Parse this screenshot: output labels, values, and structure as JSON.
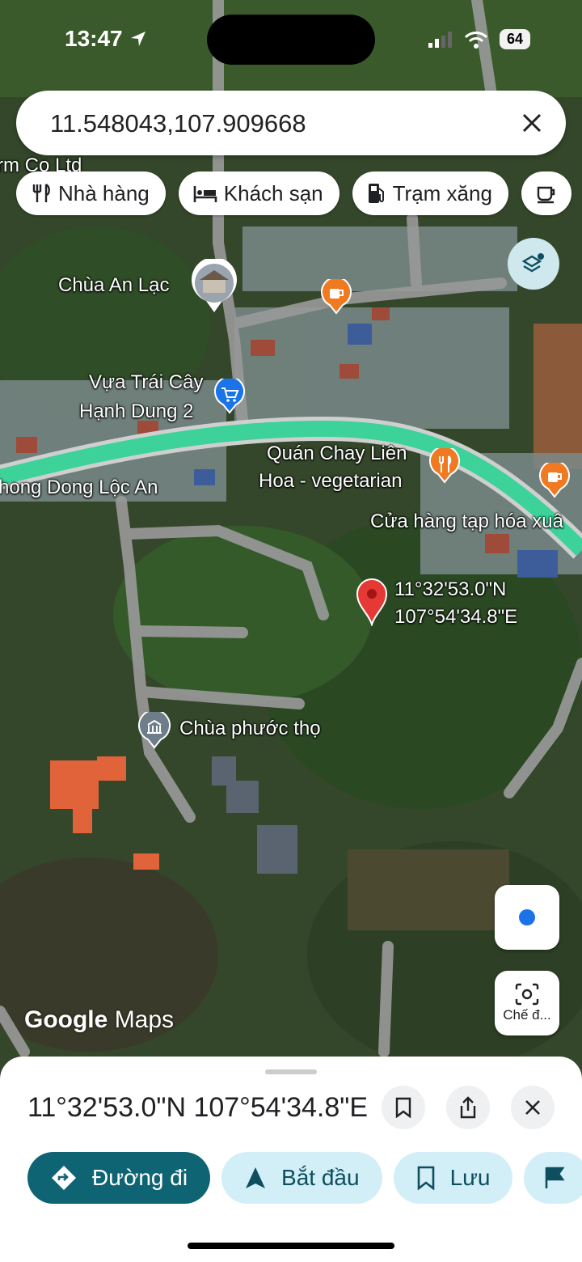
{
  "status_bar": {
    "time": "13:47",
    "battery": "64"
  },
  "search": {
    "value": "11.548043,107.909668"
  },
  "chips": [
    {
      "label": "Nhà hàng",
      "icon": "restaurant-icon"
    },
    {
      "label": "Khách sạn",
      "icon": "hotel-icon"
    },
    {
      "label": "Trạm xăng",
      "icon": "gas-station-icon"
    },
    {
      "label": "",
      "icon": "coffee-icon"
    }
  ],
  "map": {
    "labels": {
      "top_partial": "rm Co Ltd",
      "chua_an_lac": "Chùa An Lạc",
      "vua_trai_cay_1": "Vựa Trái Cây",
      "vua_trai_cay_2": "Hạnh Dung 2",
      "quan_chay_1": "Quán Chay Liên",
      "quan_chay_2": "Hoa - vegetarian",
      "phong_dong": "hong Dong Lộc An",
      "cua_hang": "Cửa hàng tạp hóa xuâ",
      "pin_lat": "11°32'53.0\"N",
      "pin_lng": "107°54'34.8\"E",
      "chua_phuoc_tho": "Chùa phước thọ"
    },
    "brand_google": "Google",
    "brand_maps": "Maps",
    "lens_label": "Chế đ..."
  },
  "sheet": {
    "title": "11°32'53.0\"N 107°54'34.8\"E",
    "actions": [
      {
        "label": "Đường đi",
        "icon": "directions-icon"
      },
      {
        "label": "Bắt đầu",
        "icon": "navigate-arrow-icon"
      },
      {
        "label": "Lưu",
        "icon": "bookmark-icon"
      },
      {
        "label": "",
        "icon": "flag-icon"
      }
    ]
  },
  "colors": {
    "primary": "#0f6474",
    "secondary_bg": "#d2eef7",
    "route": "#3cd29a",
    "pin": "#e53935",
    "poi_orange": "#f07a22",
    "poi_blue": "#1a73e8"
  }
}
